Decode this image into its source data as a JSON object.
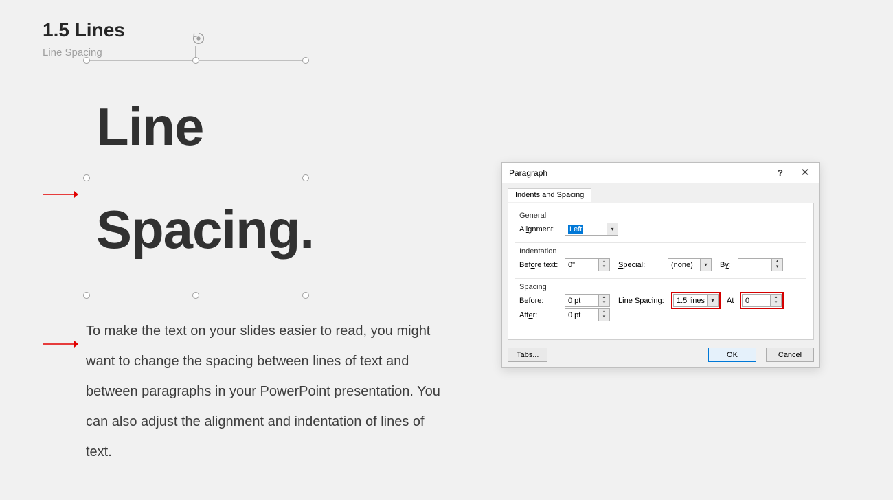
{
  "page": {
    "title": "1.5 Lines",
    "subtitle": "Line Spacing"
  },
  "textbox": {
    "line1": "Line",
    "line2": "Spacing."
  },
  "description": "To make the text on your slides easier to read, you might want to change the spacing between lines of text and between paragraphs in your PowerPoint presentation. You can also adjust the alignment and indentation of lines of text.",
  "dialog": {
    "title": "Paragraph",
    "tab": "Indents and Spacing",
    "groups": {
      "general": {
        "label": "General",
        "alignment_label": "Alignment:",
        "alignment_value": "Left"
      },
      "indentation": {
        "label": "Indentation",
        "before_text_label": "Before text:",
        "before_text_value": "0\"",
        "special_label": "Special:",
        "special_value": "(none)",
        "by_label": "By:",
        "by_value": ""
      },
      "spacing": {
        "label": "Spacing",
        "before_label": "Before:",
        "before_value": "0 pt",
        "after_label": "After:",
        "after_value": "0 pt",
        "line_spacing_label": "Line Spacing:",
        "line_spacing_value": "1.5 lines",
        "at_label": "At",
        "at_value": "0"
      }
    },
    "buttons": {
      "tabs": "Tabs...",
      "ok": "OK",
      "cancel": "Cancel"
    },
    "help": "?",
    "close": "✕"
  }
}
